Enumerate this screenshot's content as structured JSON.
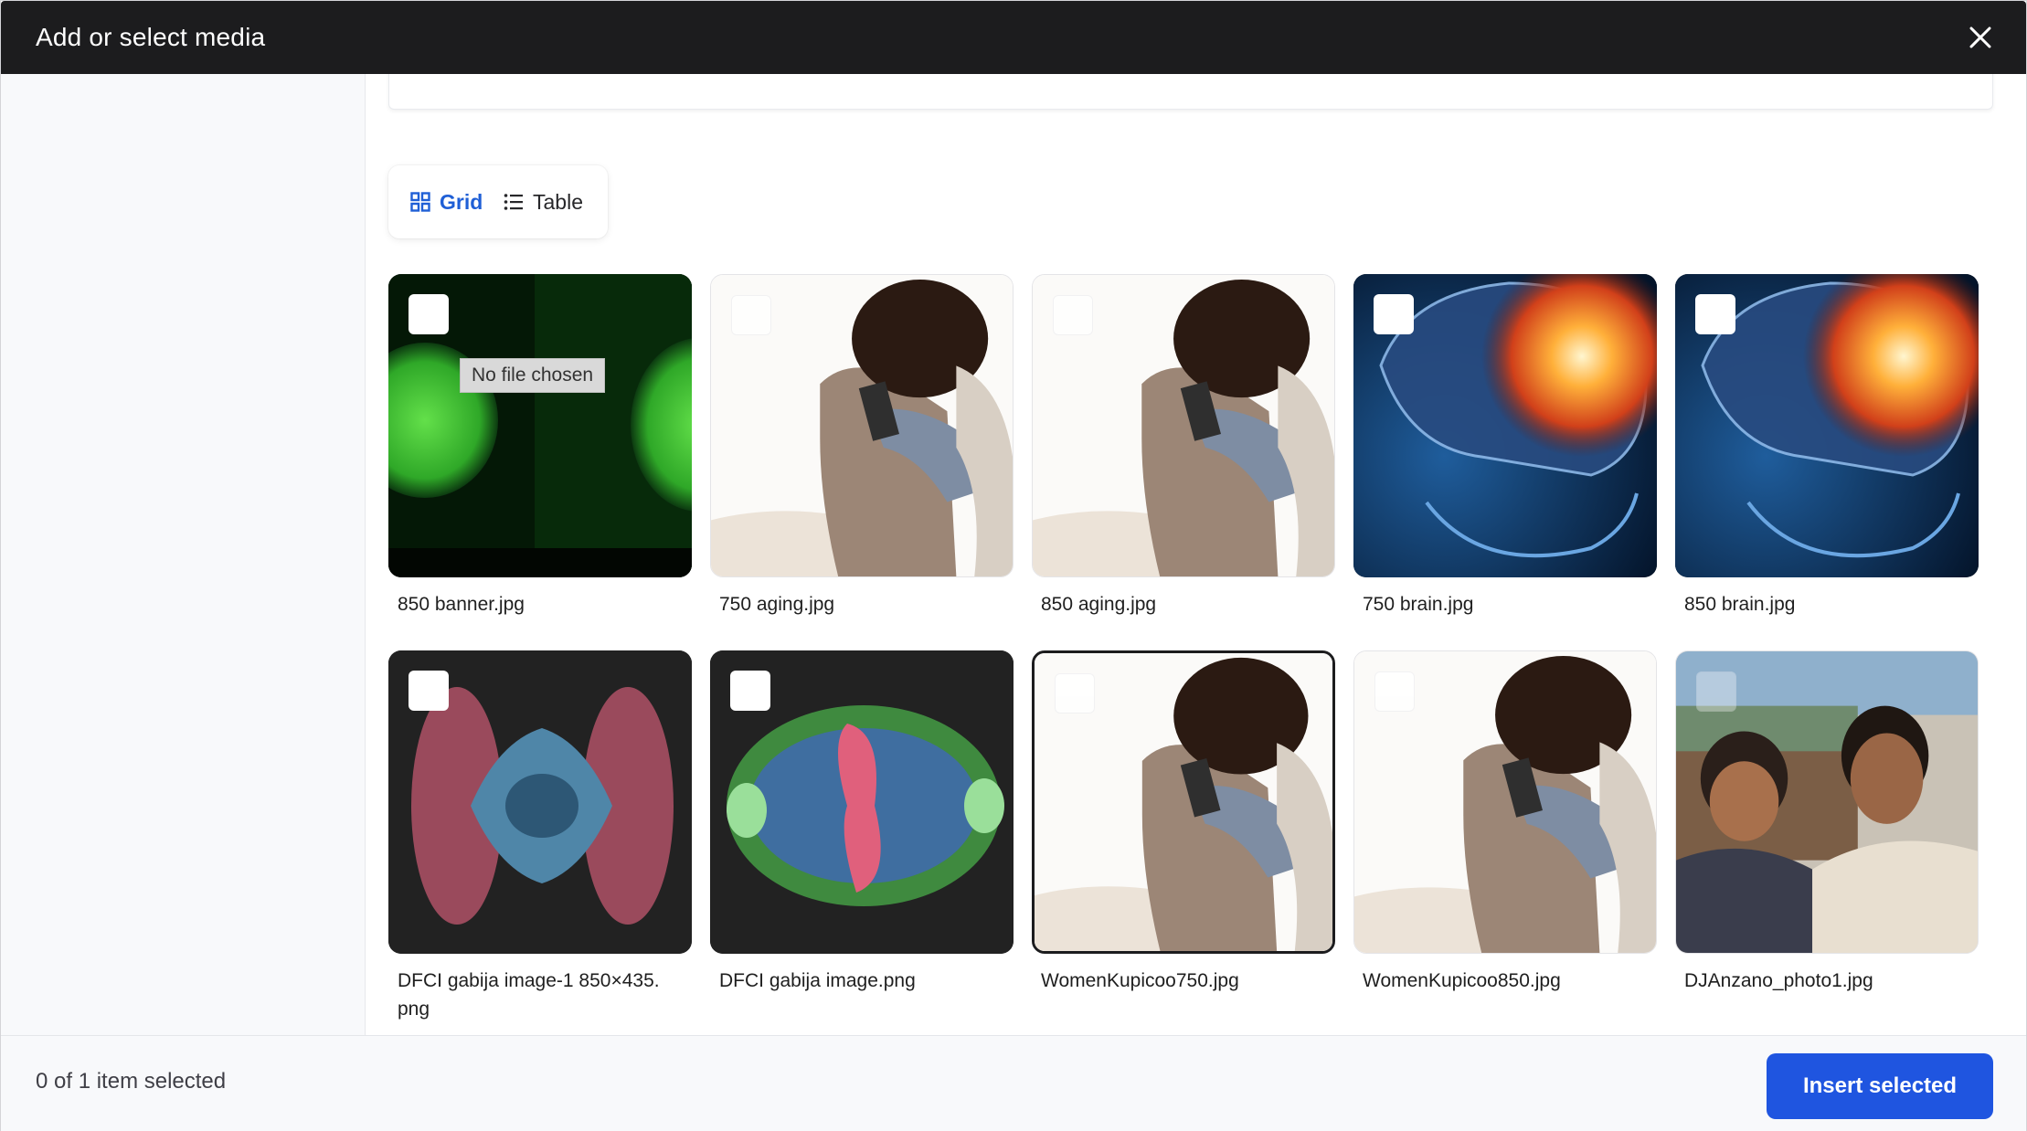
{
  "dialog": {
    "title": "Add or select media",
    "close_icon": "close-icon"
  },
  "view_toggle": {
    "grid_label": "Grid",
    "table_label": "Table",
    "active": "Grid",
    "accent_color": "#1f5fd6"
  },
  "media": [
    {
      "name": "850 banner.jpg",
      "overlay": "No file chosen"
    },
    {
      "name": "750 aging.jpg"
    },
    {
      "name": "850 aging.jpg"
    },
    {
      "name": "750 brain.jpg"
    },
    {
      "name": "850 brain.jpg"
    },
    {
      "name": "DFCI gabija image-1 850×435.\npng"
    },
    {
      "name": "DFCI gabija image.png"
    },
    {
      "name": "WomenKupicoo750.jpg"
    },
    {
      "name": "WomenKupicoo850.jpg"
    },
    {
      "name": "DJAnzano_photo1.jpg"
    }
  ],
  "footer": {
    "selection_status": "0 of 1 item selected",
    "insert_label": "Insert selected",
    "insert_color": "#1f55e0"
  }
}
